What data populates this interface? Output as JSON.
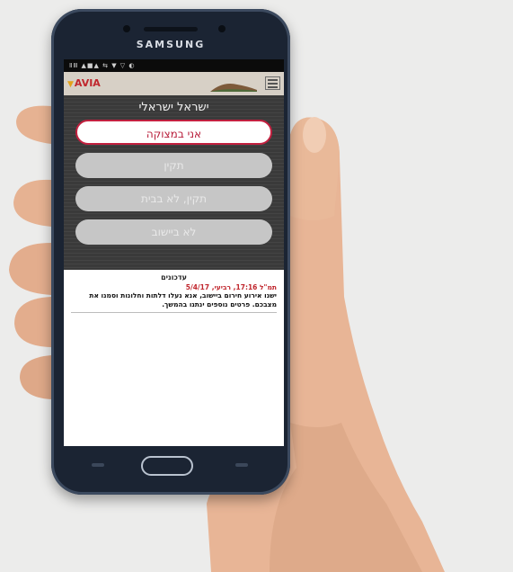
{
  "device": {
    "brand": "SAMSUNG"
  },
  "statusbar": {
    "text": "ⅡⅢ ▲■▲ ⇆ ▼ ▽ ◐"
  },
  "app": {
    "logo_text": "AVIA",
    "menu_icon": "hamburger-icon"
  },
  "panel": {
    "title": "ישראל ישראלי",
    "buttons": [
      {
        "label": "אני במצוקה"
      },
      {
        "label": "תקין"
      },
      {
        "label": "תקין, לא בבית"
      },
      {
        "label": "לא ביישוב"
      }
    ]
  },
  "updates": {
    "title": "עדכונים",
    "date": "תמ\"ל 17:16, רביעי, 5/4/17",
    "text": "ישנו אירוע חירום ביישוב, אנא נעלו דלתות וחלונות וסמנו את מצבכם. פרטים נוספים ינתנו בהמשך."
  },
  "colors": {
    "accent": "#c2203f",
    "panel_bg": "#3a3a3a",
    "appbar_bg": "#d7d0c6",
    "phone_body": "#1b2433"
  }
}
